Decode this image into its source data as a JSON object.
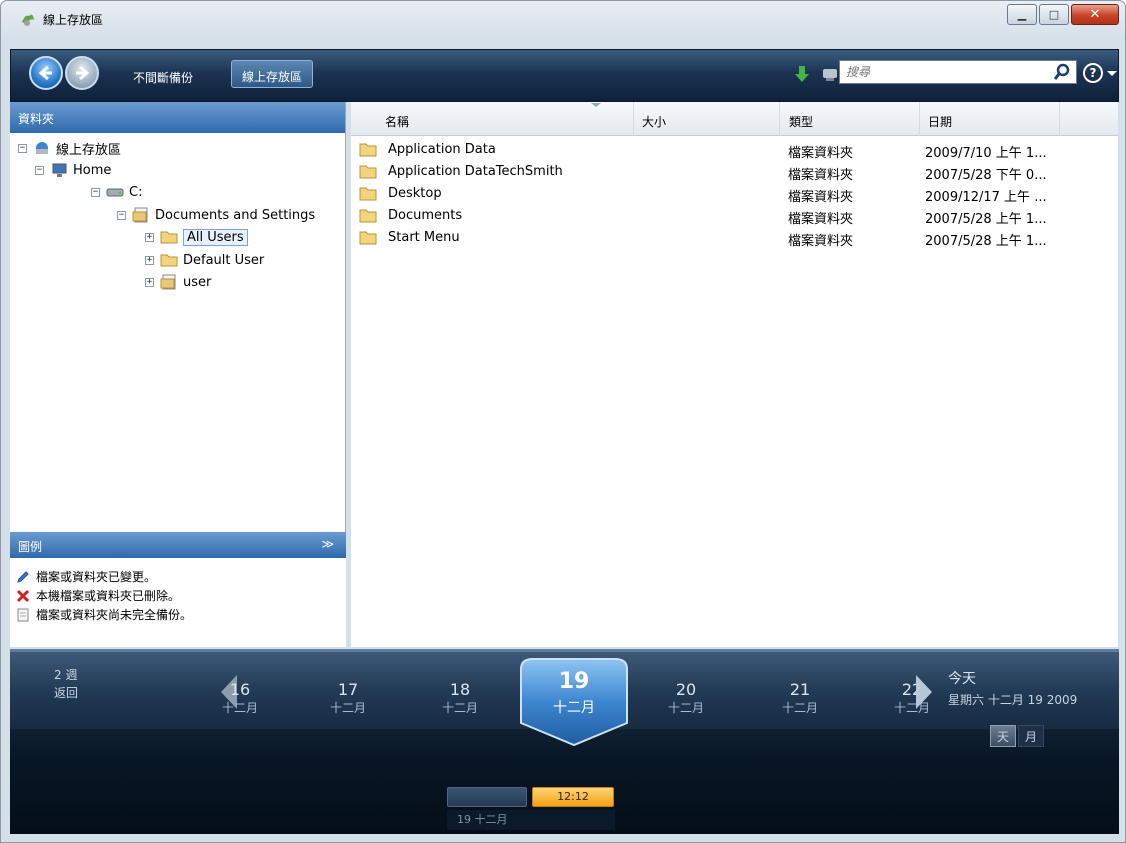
{
  "window": {
    "title": "線上存放區"
  },
  "toolbar": {
    "link_continuous_backup": "不間斷備份",
    "tab_online_storage": "線上存放區",
    "search_placeholder": "搜尋"
  },
  "folders_panel": {
    "title": "資料夾",
    "tree": [
      {
        "label": "線上存放區",
        "icon": "online-storage-icon",
        "expander": "−"
      },
      {
        "label": "Home",
        "icon": "computer-icon",
        "expander": "−"
      },
      {
        "label": "C:",
        "icon": "drive-icon",
        "expander": "−"
      },
      {
        "label": "Documents and Settings",
        "icon": "partial-folder-icon",
        "expander": "−"
      },
      {
        "label": "All Users",
        "icon": "folder-icon",
        "expander": "+",
        "selected": true
      },
      {
        "label": "Default User",
        "icon": "folder-icon",
        "expander": "+"
      },
      {
        "label": "user",
        "icon": "partial-folder-icon",
        "expander": "+"
      }
    ]
  },
  "legend": {
    "title": "圖例",
    "items": [
      {
        "icon": "pencil-icon",
        "text": "檔案或資料夾已變更。"
      },
      {
        "icon": "deleted-icon",
        "text": "本機檔案或資料夾已刪除。"
      },
      {
        "icon": "partial-icon",
        "text": "檔案或資料夾尚未完全備份。"
      }
    ]
  },
  "file_list": {
    "columns": [
      "名稱",
      "大小",
      "類型",
      "日期"
    ],
    "rows": [
      {
        "name": "Application Data",
        "size": "",
        "type": "檔案資料夾",
        "date": "2009/7/10 上午 1..."
      },
      {
        "name": "Application DataTechSmith",
        "size": "",
        "type": "檔案資料夾",
        "date": "2007/5/28 下午 0..."
      },
      {
        "name": "Desktop",
        "size": "",
        "type": "檔案資料夾",
        "date": "2009/12/17 上午 ..."
      },
      {
        "name": "Documents",
        "size": "",
        "type": "檔案資料夾",
        "date": "2007/5/28 上午 1..."
      },
      {
        "name": "Start Menu",
        "size": "",
        "type": "檔案資料夾",
        "date": "2007/5/28 上午 1..."
      }
    ]
  },
  "timeline": {
    "back_line1": "2 週",
    "back_line2": "返回",
    "days": [
      {
        "num": "16",
        "month": "十二月"
      },
      {
        "num": "17",
        "month": "十二月"
      },
      {
        "num": "18",
        "month": "十二月"
      },
      {
        "num": "19",
        "month": "十二月"
      },
      {
        "num": "20",
        "month": "十二月"
      },
      {
        "num": "21",
        "month": "十二月"
      },
      {
        "num": "22",
        "month": "十二月"
      }
    ],
    "today_label": "今天",
    "today_date": "星期六 十二月 19 2009",
    "view_day": "天",
    "view_month": "月",
    "time": "12:12",
    "slot_date": "19 十二月"
  },
  "colors": {
    "accent": "#2f6aad",
    "timeline_bg": "#081624",
    "time_badge": "#f2a20f"
  }
}
